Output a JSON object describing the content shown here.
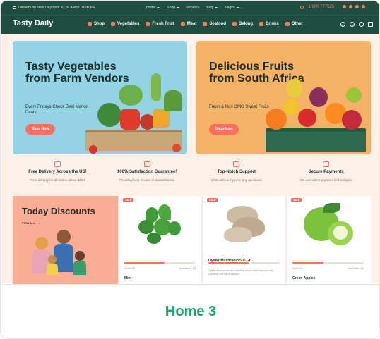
{
  "topbar": {
    "promo": "Delivery on Next Day from 10:00 AM to 08:00 PM",
    "nav": [
      "Home",
      "Shop",
      "Vendors",
      "Blog",
      "Pages"
    ],
    "phone": "+1 900 777525"
  },
  "header": {
    "logo": "Tasty Daily",
    "categories": [
      "Shop",
      "Vegetables",
      "Fresh Fruit",
      "Meat",
      "Seafood",
      "Baking",
      "Drinks",
      "Other"
    ]
  },
  "banners": [
    {
      "title": "Tasty Vegetables from Farm Vendors",
      "subtitle": "Every Fridays Check Best Market Deals!",
      "button": "Shop Now"
    },
    {
      "title": "Delicious Fruits from South Africa",
      "subtitle": "Fresh & Non GMO Sweet Fruits",
      "button": "Shop Now"
    }
  ],
  "features": [
    {
      "title": "Free Delivery Across the US!",
      "desc": "Free delivery for all orders above $100"
    },
    {
      "title": "100% Satisfaction Guarantee!",
      "desc": "Providing help in case of dissatisfaction"
    },
    {
      "title": "Top-Notch Support",
      "desc": "Chat with us if you've any questions"
    },
    {
      "title": "Secure Payments",
      "desc": "We use safest payment technologies"
    }
  ],
  "discounts": {
    "title": "Today Discounts",
    "link": "VIEW ALL"
  },
  "products": [
    {
      "badge": "SALE",
      "name": "Mint",
      "sold": "Sold: 19",
      "available": "Available: 15",
      "progress": 0.56,
      "desc": ""
    },
    {
      "badge": "SALE",
      "name": "Oyster Mushroom 500 Gr",
      "sold": "Sold: 19",
      "available": "Available: 15",
      "progress": 0.56,
      "desc": "Oyster Mushrooms are a healthy choice since they are very nutritious and low in calories."
    },
    {
      "badge": "SALE",
      "name": "Green Apples",
      "sold": "Sold: 24",
      "available": "Available: 30",
      "progress": 0.44,
      "desc": ""
    }
  ],
  "label": "Home 3",
  "colors": {
    "dark_green": "#1f4d40",
    "coral": "#ff6f5f",
    "label_green": "#1aa56a"
  }
}
